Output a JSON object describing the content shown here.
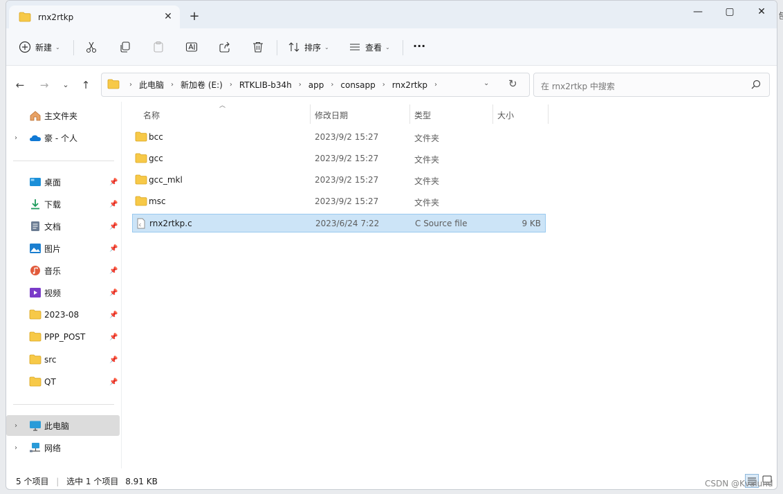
{
  "tab": {
    "title": "rnx2rtkp",
    "close": "✕",
    "new": "+"
  },
  "window_controls": {
    "minimize": "—",
    "maximize": "▢",
    "close": "✕"
  },
  "toolbar": {
    "new_label": "新建",
    "sort_label": "排序",
    "view_label": "查看",
    "more": "···"
  },
  "address": {
    "crumbs": [
      "此电脑",
      "新加卷 (E:)",
      "RTKLIB-b34h",
      "app",
      "consapp",
      "rnx2rtkp"
    ]
  },
  "search": {
    "placeholder": "在 rnx2rtkp 中搜索"
  },
  "sidebar": {
    "items": [
      {
        "label": "主文件夹",
        "icon": "home-icon"
      },
      {
        "label": "豪 - 个人",
        "icon": "onedrive-icon"
      },
      {
        "label": "桌面",
        "icon": "desktop-icon"
      },
      {
        "label": "下载",
        "icon": "download-icon"
      },
      {
        "label": "文档",
        "icon": "document-icon"
      },
      {
        "label": "图片",
        "icon": "pictures-icon"
      },
      {
        "label": "音乐",
        "icon": "music-icon"
      },
      {
        "label": "视频",
        "icon": "video-icon"
      },
      {
        "label": "2023-08",
        "icon": "folder-icon"
      },
      {
        "label": "PPP_POST",
        "icon": "folder-icon"
      },
      {
        "label": "src",
        "icon": "folder-icon"
      },
      {
        "label": "QT",
        "icon": "folder-icon"
      },
      {
        "label": "此电脑",
        "icon": "computer-icon"
      },
      {
        "label": "网络",
        "icon": "network-icon"
      }
    ]
  },
  "columns": {
    "name": "名称",
    "date": "修改日期",
    "type": "类型",
    "size": "大小"
  },
  "files": [
    {
      "name": "bcc",
      "date": "2023/9/2 15:27",
      "type": "文件夹",
      "size": ""
    },
    {
      "name": "gcc",
      "date": "2023/9/2 15:27",
      "type": "文件夹",
      "size": ""
    },
    {
      "name": "gcc_mkl",
      "date": "2023/9/2 15:27",
      "type": "文件夹",
      "size": ""
    },
    {
      "name": "msc",
      "date": "2023/9/2 15:27",
      "type": "文件夹",
      "size": ""
    },
    {
      "name": "rnx2rtkp.c",
      "date": "2023/6/24 7:22",
      "type": "C Source file",
      "size": "9 KB"
    }
  ],
  "status": {
    "count": "5 个项目",
    "selection": "选中 1 个项目",
    "size": "8.91 KB"
  },
  "watermark": "CSDN @Kvalund",
  "edge_char": "刨",
  "colors": {
    "folder": "#f7c948",
    "selection": "#cce4f7",
    "accent": "#0067c0"
  }
}
